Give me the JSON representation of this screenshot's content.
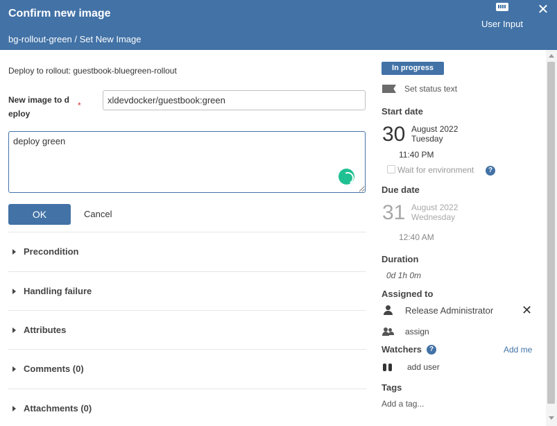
{
  "dialog": {
    "title": "Confirm new image",
    "subtitle": "bg-rollout-green / Set New Image",
    "user_input_label": "User Input",
    "close_glyph": "✕"
  },
  "form": {
    "deploy_line": "Deploy to rollout: guestbook-bluegreen-rollout",
    "new_image_label": "New image to d eploy",
    "required_mark": "*",
    "new_image_value": "xldevdocker/guestbook:green",
    "comment_value": "deploy green",
    "ok_label": "OK",
    "cancel_label": "Cancel"
  },
  "sections": [
    {
      "label": "Precondition"
    },
    {
      "label": "Handling failure"
    },
    {
      "label": "Attributes"
    },
    {
      "label": "Comments (0)"
    },
    {
      "label": "Attachments (0)"
    }
  ],
  "task": {
    "status_badge": "In progress",
    "set_status_text": "Set status text",
    "start_date": {
      "heading": "Start date",
      "day": "30",
      "month_year": "August 2022",
      "weekday": "Tuesday",
      "time": "11:40 PM"
    },
    "wait_for_environment": "Wait for environment",
    "wait_checked": false,
    "due_date": {
      "heading": "Due date",
      "day": "31",
      "month_year": "August 2022",
      "weekday": "Wednesday",
      "time": "12:40 AM"
    },
    "duration": {
      "heading": "Duration",
      "value": "0d 1h 0m"
    },
    "assigned_to": {
      "heading": "Assigned to",
      "user": "Release Administrator",
      "remove_glyph": "✕",
      "assign_label": "assign"
    },
    "watchers": {
      "heading": "Watchers",
      "add_me": "Add me",
      "add_user": "add user"
    },
    "tags": {
      "heading": "Tags",
      "placeholder": "Add a tag..."
    },
    "help_glyph": "?"
  },
  "colors": {
    "header_bg": "#4272a6",
    "primary": "#4272a6",
    "spinner": "#1fc092",
    "required": "#c9302c"
  }
}
